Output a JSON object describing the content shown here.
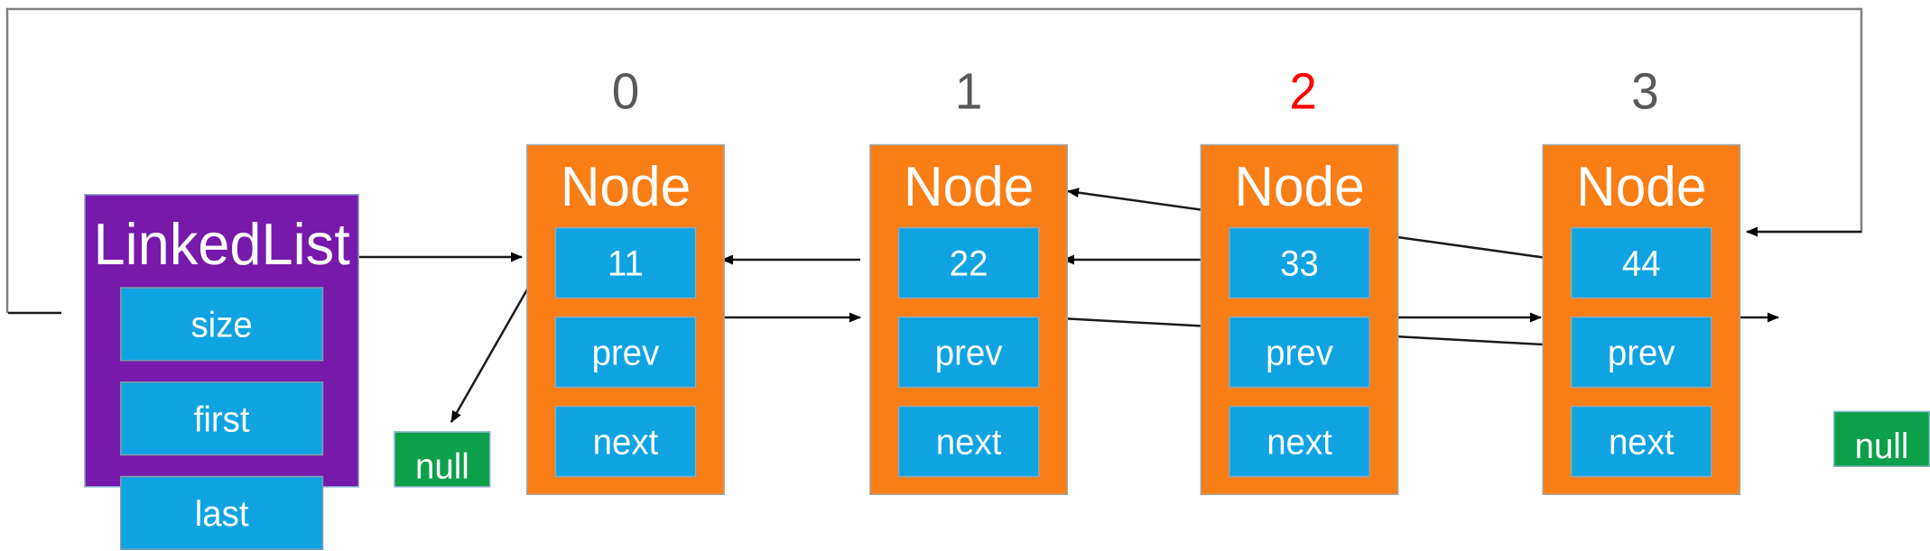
{
  "diagram": {
    "title_text": "LinkedList doubly-linked node diagram",
    "colors": {
      "list_box": "#7719AA",
      "node_box": "#FA7E16",
      "field_box": "#0FA3E2",
      "null_box": "#0DA04A",
      "index_label": "#595959",
      "index_highlight": "#FF0000",
      "arrow": "#000000",
      "outer_border": "#808080"
    }
  },
  "list": {
    "title": "LinkedList",
    "fields": [
      {
        "label": "size"
      },
      {
        "label": "first"
      },
      {
        "label": "last"
      }
    ]
  },
  "indexes": [
    {
      "label": "0",
      "highlight": false
    },
    {
      "label": "1",
      "highlight": false
    },
    {
      "label": "2",
      "highlight": true
    },
    {
      "label": "3",
      "highlight": false
    }
  ],
  "nodes": [
    {
      "title": "Node",
      "value": "11",
      "prev_label": "prev",
      "next_label": "next"
    },
    {
      "title": "Node",
      "value": "22",
      "prev_label": "prev",
      "next_label": "next"
    },
    {
      "title": "Node",
      "value": "33",
      "prev_label": "prev",
      "next_label": "next"
    },
    {
      "title": "Node",
      "value": "44",
      "prev_label": "prev",
      "next_label": "next"
    }
  ],
  "nulls": [
    {
      "label": "null"
    },
    {
      "label": "null"
    }
  ]
}
